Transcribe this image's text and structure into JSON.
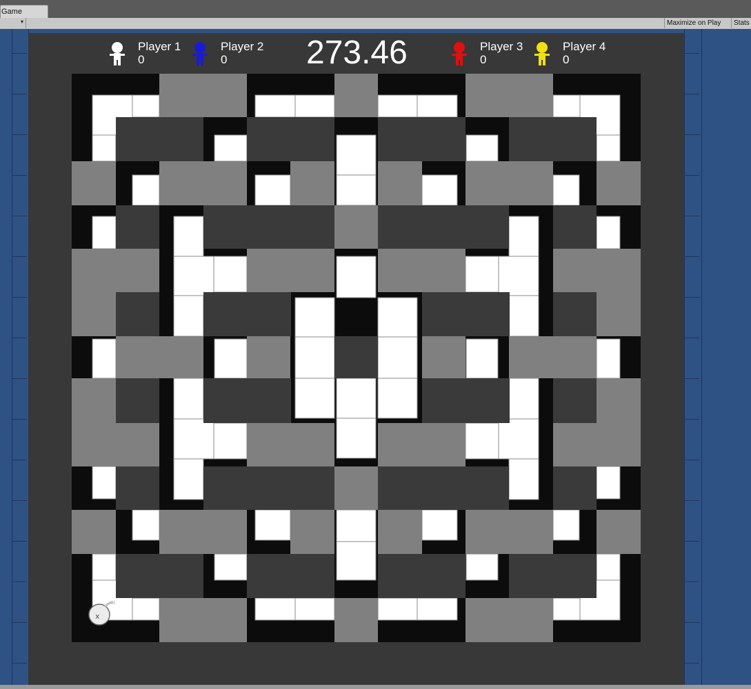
{
  "editor": {
    "window_tab": "Game",
    "toolbar": {
      "maximize_label": "Maximize on Play",
      "stats_label": "Stats"
    }
  },
  "hud": {
    "timer": "273.46",
    "players": [
      {
        "name": "Player 1",
        "score": "0",
        "color": "#ffffff"
      },
      {
        "name": "Player 2",
        "score": "0",
        "color": "#1a1ad6"
      },
      {
        "name": "Player 3",
        "score": "0",
        "color": "#e01010"
      },
      {
        "name": "Player 4",
        "score": "0",
        "color": "#f0e010"
      }
    ]
  },
  "board": {
    "tile_colors": {
      "floor": "#ffffff",
      "crate": "#808080",
      "wall": "#3a3a3a",
      "border": "#0c0c0c"
    }
  },
  "icons": {
    "player": "player-icon",
    "bomb": "bomb-icon"
  }
}
